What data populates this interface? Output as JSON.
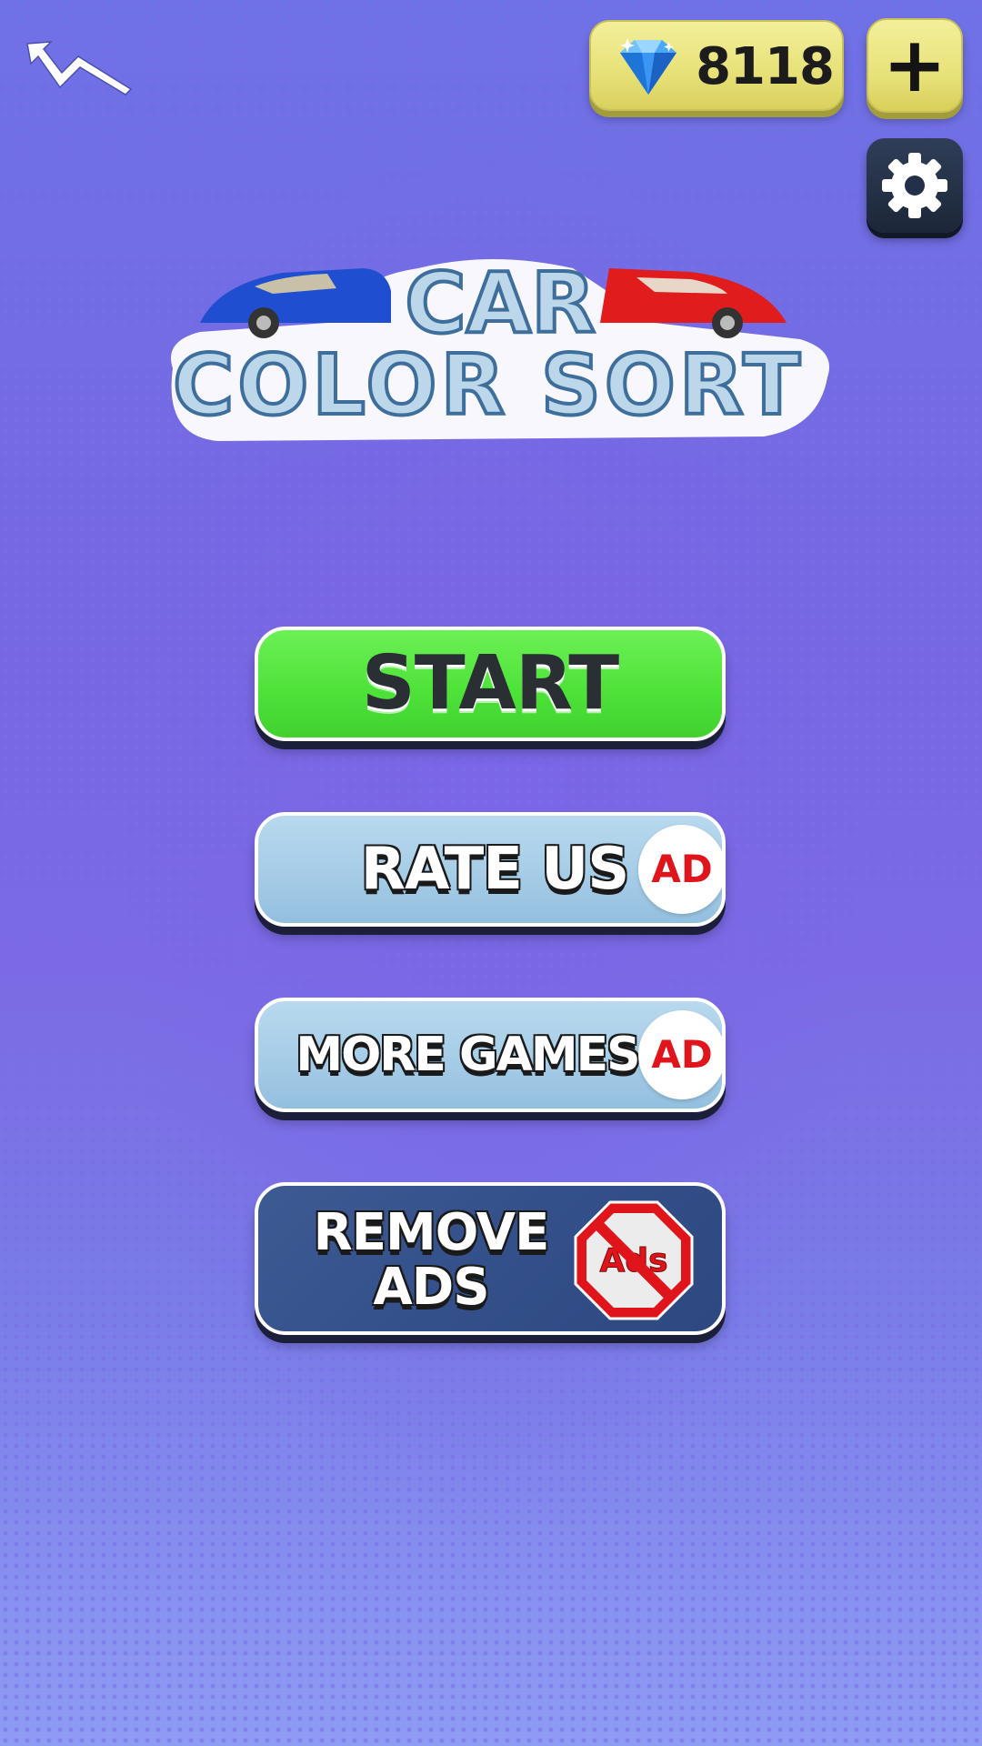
{
  "header": {
    "gem_count": "8118",
    "plus_label": "+",
    "icons": {
      "back": "lightning-back-icon",
      "gem": "diamond-gem-icon",
      "settings": "gear-icon"
    }
  },
  "logo": {
    "line1": "CAR",
    "line2": "COLOR SORT",
    "car_colors": [
      "#1f4fd0",
      "#e01c1c"
    ]
  },
  "menu": {
    "start_label": "START",
    "rate_label": "RATE US",
    "more_label": "MORE GAMES",
    "remove_label_1": "REMOVE",
    "remove_label_2": "ADS",
    "ad_badge": "AD",
    "no_ads_icon_text": "Ads"
  },
  "colors": {
    "background": "#7a6ee6",
    "start_green": "#4fe33a",
    "light_blue": "#a4cbe6",
    "dark_blue": "#34508a",
    "gem_yellow": "#e8e27a",
    "ad_red": "#e0141b"
  }
}
